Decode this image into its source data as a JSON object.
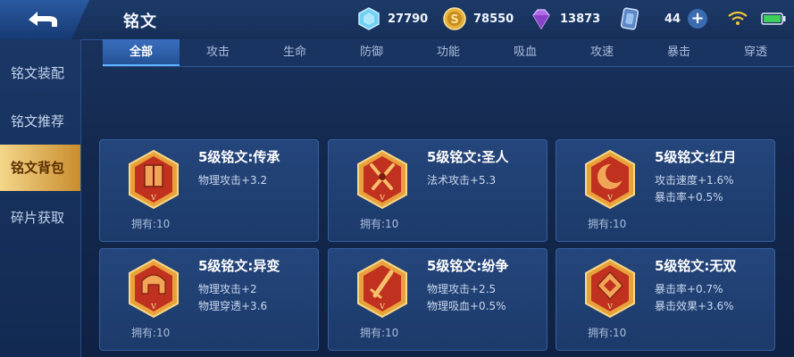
{
  "header": {
    "title": "铭文",
    "resources": [
      {
        "icon": "diamond-icon",
        "value": "27790"
      },
      {
        "icon": "gold-coin-icon",
        "value": "78550"
      },
      {
        "icon": "crystal-icon",
        "value": "13873"
      },
      {
        "icon": "inscription-fragment-icon",
        "value": "44"
      }
    ],
    "add_label": "+"
  },
  "sidebar": {
    "items": [
      {
        "label": "铭文装配"
      },
      {
        "label": "铭文推荐"
      },
      {
        "label": "铭文背包"
      },
      {
        "label": "碎片获取"
      }
    ],
    "active_index": 2
  },
  "tabs": {
    "items": [
      "全部",
      "攻击",
      "生命",
      "防御",
      "功能",
      "吸血",
      "攻速",
      "暴击",
      "穿透"
    ],
    "active_index": 0
  },
  "cards": [
    {
      "name": "5级铭文:传承",
      "stats": [
        "物理攻击+3.2"
      ],
      "owned": "拥有:10",
      "icon": "banner-icon"
    },
    {
      "name": "5级铭文:圣人",
      "stats": [
        "法术攻击+5.3"
      ],
      "owned": "拥有:10",
      "icon": "crossed-swords-icon"
    },
    {
      "name": "5级铭文:红月",
      "stats": [
        "攻击速度+1.6%",
        "暴击率+0.5%"
      ],
      "owned": "拥有:10",
      "icon": "crescent-moon-icon"
    },
    {
      "name": "5级铭文:异变",
      "stats": [
        "物理攻击+2",
        "物理穿透+3.6"
      ],
      "owned": "拥有:10",
      "icon": "helmet-icon"
    },
    {
      "name": "5级铭文:纷争",
      "stats": [
        "物理攻击+2.5",
        "物理吸血+0.5%"
      ],
      "owned": "拥有:10",
      "icon": "sword-icon"
    },
    {
      "name": "5级铭文:无双",
      "stats": [
        "暴击率+0.7%",
        "暴击效果+3.6%"
      ],
      "owned": "拥有:10",
      "icon": "gem-icon"
    }
  ],
  "colors": {
    "accent_gold": "#f4d68a",
    "badge_red": "#c0311f",
    "badge_gold": "#e9a23b",
    "tab_active": "#3a6fbe"
  }
}
